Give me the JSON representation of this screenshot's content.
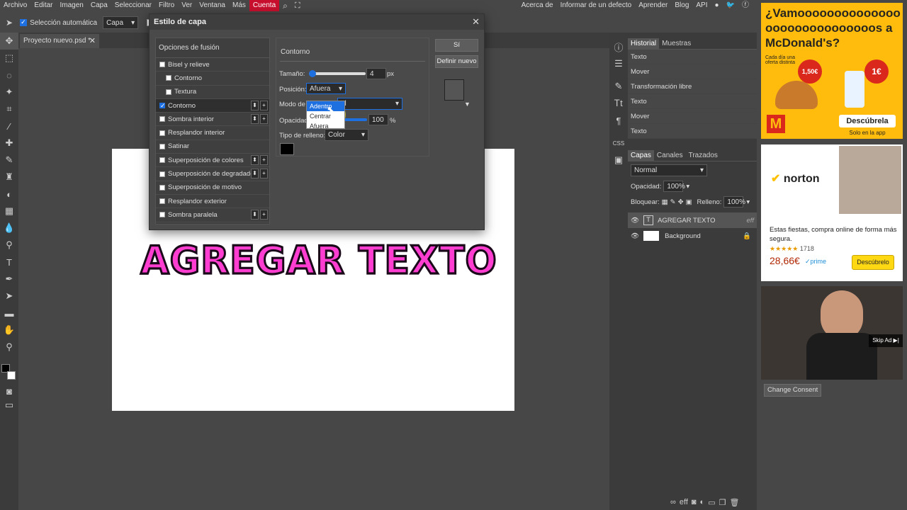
{
  "menu": [
    "Archivo",
    "Editar",
    "Imagen",
    "Capa",
    "Seleccionar",
    "Filtro",
    "Ver",
    "Ventana",
    "Más",
    "Cuenta"
  ],
  "menu_right": [
    "Acerca de",
    "Informar de un defecto",
    "Aprender",
    "Blog",
    "API"
  ],
  "options_bar": {
    "auto_select_label": "Selección automática",
    "auto_select_value": "Capa"
  },
  "doc_tab": "Proyecto nuevo.psd *",
  "canvas_text": "AGREGAR TEXTO",
  "dialog": {
    "title": "Estilo de capa",
    "fx_header": "Opciones de fusión",
    "fx_items": [
      {
        "label": "Bisel y relieve",
        "checked": false,
        "sub": false,
        "arrows": false
      },
      {
        "label": "Contorno",
        "checked": false,
        "sub": true,
        "arrows": false
      },
      {
        "label": "Textura",
        "checked": false,
        "sub": true,
        "arrows": false
      },
      {
        "label": "Contorno",
        "checked": true,
        "sub": false,
        "arrows": true
      },
      {
        "label": "Sombra interior",
        "checked": false,
        "sub": false,
        "arrows": true
      },
      {
        "label": "Resplandor interior",
        "checked": false,
        "sub": false,
        "arrows": false
      },
      {
        "label": "Satinar",
        "checked": false,
        "sub": false,
        "arrows": false
      },
      {
        "label": "Superposición de colores",
        "checked": false,
        "sub": false,
        "arrows": true
      },
      {
        "label": "Superposición de degradado",
        "checked": false,
        "sub": false,
        "arrows": true
      },
      {
        "label": "Superposición de motivo",
        "checked": false,
        "sub": false,
        "arrows": false
      },
      {
        "label": "Resplandor exterior",
        "checked": false,
        "sub": false,
        "arrows": false
      },
      {
        "label": "Sombra paralela",
        "checked": false,
        "sub": false,
        "arrows": true
      }
    ],
    "panel_title": "Contorno",
    "size_label": "Tamaño:",
    "size_value": "4",
    "size_unit": "px",
    "position_label": "Posición:",
    "position_value": "Afuera",
    "position_options": [
      "Adentro",
      "Centrar",
      "Afuera"
    ],
    "blend_label": "Modo de",
    "blend_value": "al",
    "opacity_label": "Opacidad",
    "opacity_value": "100",
    "opacity_unit": "%",
    "fill_label": "Tipo de relleno:",
    "fill_value": "Color",
    "ok_button": "Sí",
    "new_button": "Definir nuevo"
  },
  "history": {
    "tabs": [
      "Historial",
      "Muestras"
    ],
    "items": [
      "Texto",
      "Mover",
      "Transformación libre",
      "Texto",
      "Mover",
      "Texto"
    ]
  },
  "layers": {
    "tabs": [
      "Capas",
      "Canales",
      "Trazados"
    ],
    "blend": "Normal",
    "opacity_label": "Opacidad:",
    "opacity": "100%",
    "lock_label": "Bloquear:",
    "fill_label": "Relleno:",
    "fill": "100%",
    "items": [
      {
        "name": "AGREGAR TEXTO",
        "fx": "eff"
      },
      {
        "name": "Background",
        "fx": ""
      }
    ]
  },
  "ads": {
    "mcd_text": "¿Vamoooooooooooooo ooooooooooooooos a McDonald's?",
    "mcd_cta": "Descúbrela",
    "mcd_sub": "Solo en la app",
    "mcd_small": "Cada día una oferta distinta",
    "mcd_p1": "1,50€",
    "mcd_p2": "1€",
    "norton_brand": "norton",
    "norton_text": "Estas fiestas, compra online de forma más segura.",
    "norton_reviews": "1718",
    "norton_price": "28,66€",
    "norton_cta": "Descúbrelo",
    "norton_prime": "✓prime",
    "skip_ad": "Skip Ad ▶|",
    "consent": "Change Consent"
  }
}
